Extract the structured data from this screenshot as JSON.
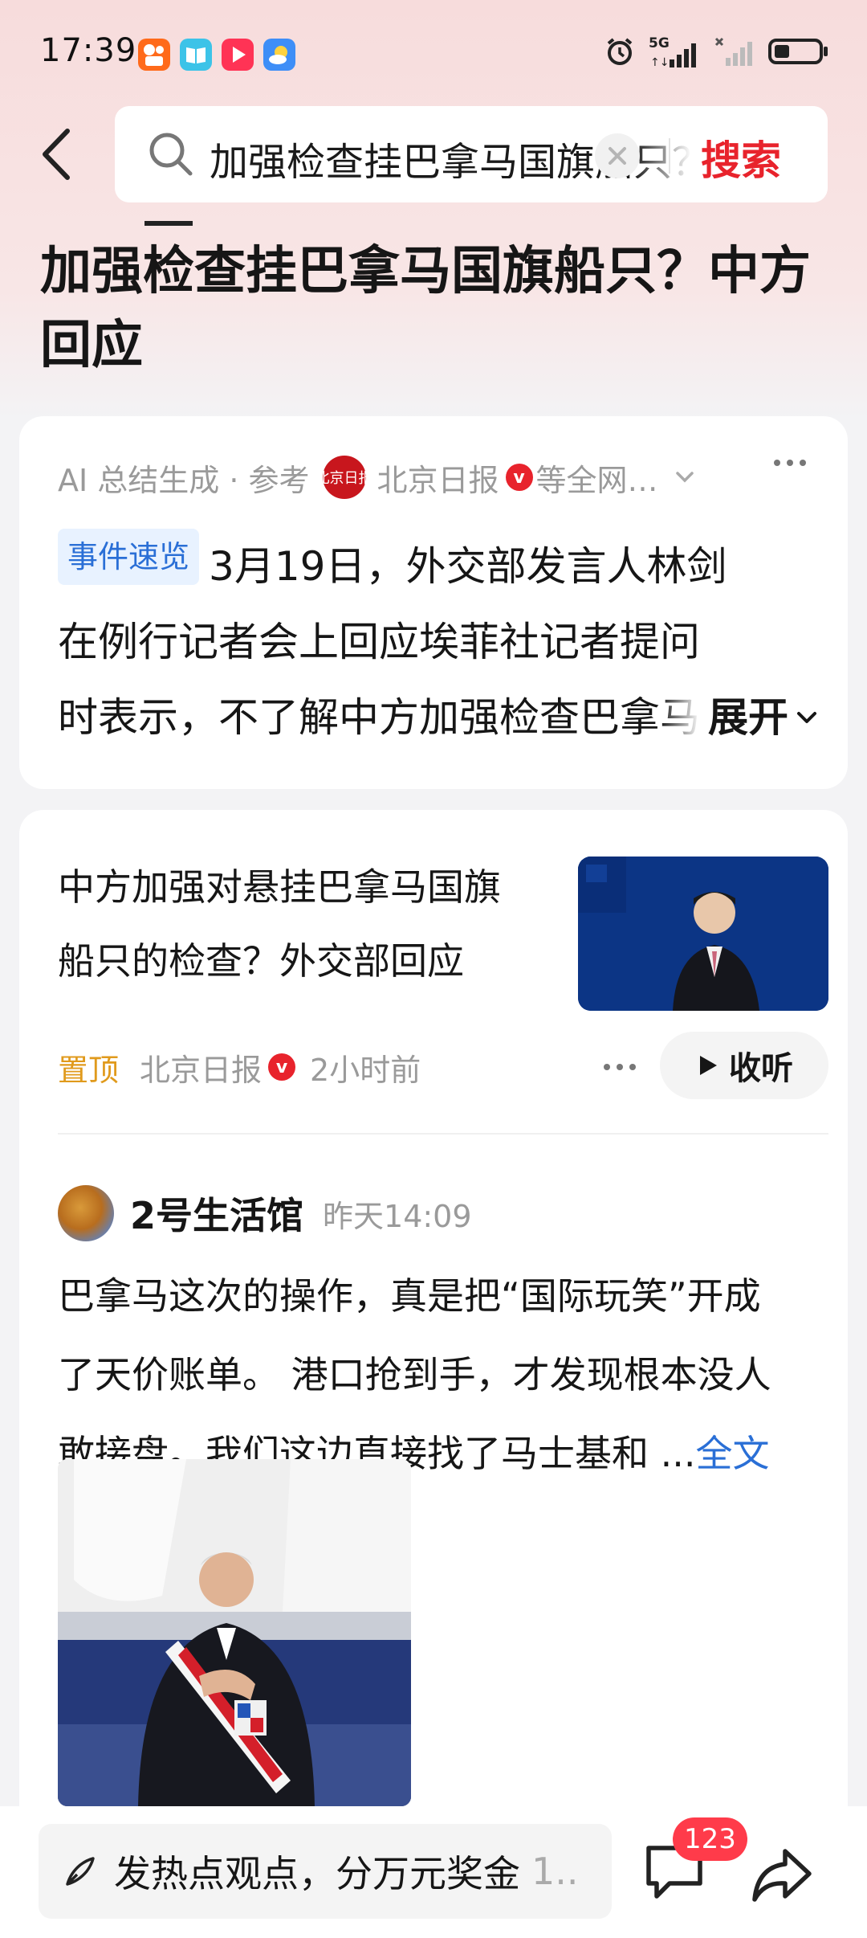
{
  "status_bar": {
    "time": "17:39",
    "network": "5G",
    "app_icons": [
      "kuaishou-icon",
      "book-icon",
      "video-icon",
      "weather-icon"
    ]
  },
  "header": {
    "search_query": "加强检查挂巴拿马国旗船只？中方回应",
    "search_button": "搜索"
  },
  "page_title": "加强检查挂巴拿马国旗船只？中方回应",
  "ai_summary": {
    "source_label": "AI 总结生成 · 参考",
    "logo_text": "北京日报",
    "source_name": "北京日报",
    "verified_mark": "v",
    "more_sources": "等全网…",
    "tag": "事件速览",
    "lines": [
      "3月19日，外交部发言人林剑",
      "在例行记者会上回应埃菲社记者提问",
      "时表示，不了解中方加强检查巴拿马"
    ],
    "expand_label": "展开"
  },
  "news": {
    "title_lines": [
      "中方加强对悬挂巴拿马国旗",
      "船只的检查？外交部回应"
    ],
    "pin_label": "置顶",
    "source": "北京日报",
    "verified_mark": "v",
    "time": "2小时前",
    "listen_label": "收听"
  },
  "post": {
    "author": "2号生活馆",
    "time": "昨天14:09",
    "lines": [
      "巴拿马这次的操作，真是把“国际玩笑”开成",
      "了天价账单。 港口抢到手，才发现根本没人",
      "敢接盘。我们这边直接找了马士基和 ..."
    ],
    "full_text_label": "全文"
  },
  "bottom_bar": {
    "comment_placeholder": "发热点观点，分万元奖金",
    "comment_suffix": "1..",
    "comment_count": "123"
  },
  "colors": {
    "accent_red": "#e8232c",
    "link_blue": "#2a6fd6",
    "pin_orange": "#e09a1c"
  }
}
